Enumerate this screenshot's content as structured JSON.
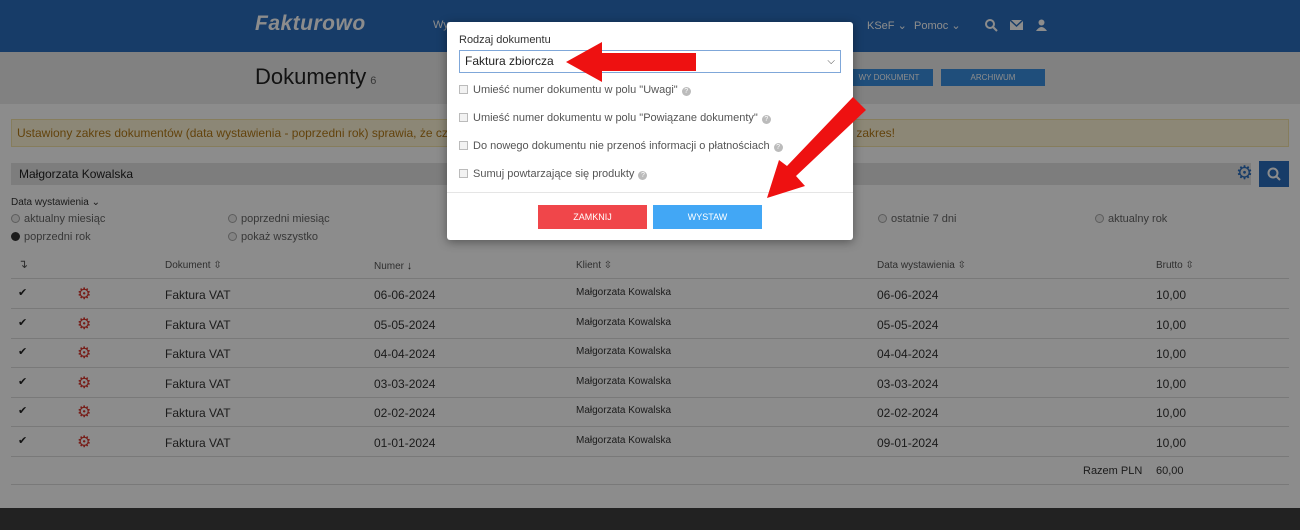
{
  "nav": {
    "logo": "Fakturowo",
    "first_item_partial": "Wy",
    "ksef": "KSeF",
    "help": "Pomoc"
  },
  "header": {
    "title": "Dokumenty",
    "count": "6",
    "new_doc_partial": "WY DOKUMENT",
    "archive": "ARCHIWUM"
  },
  "alert": {
    "text_start": "Ustawiony zakres dokumentów (data wystawienia - poprzedni rok) sprawia, że część d",
    "text_end": "y zakres!"
  },
  "client": {
    "name": "Małgorzata Kowalska"
  },
  "filter": {
    "label": "Data wystawienia",
    "options": [
      "aktualny miesiąc",
      "poprzedni miesiąc",
      "ostatnie 7 dni",
      "aktualny rok",
      "poprzedni rok",
      "pokaż wszystko"
    ],
    "selected": "poprzedni rok"
  },
  "table": {
    "headers": {
      "document": "Dokument",
      "number": "Numer",
      "client": "Klient",
      "date": "Data wystawienia",
      "gross": "Brutto"
    },
    "rows": [
      {
        "document": "Faktura VAT",
        "number": "06-06-2024",
        "client": "Małgorzata Kowalska",
        "date": "06-06-2024",
        "gross": "10,00"
      },
      {
        "document": "Faktura VAT",
        "number": "05-05-2024",
        "client": "Małgorzata Kowalska",
        "date": "05-05-2024",
        "gross": "10,00"
      },
      {
        "document": "Faktura VAT",
        "number": "04-04-2024",
        "client": "Małgorzata Kowalska",
        "date": "04-04-2024",
        "gross": "10,00"
      },
      {
        "document": "Faktura VAT",
        "number": "03-03-2024",
        "client": "Małgorzata Kowalska",
        "date": "03-03-2024",
        "gross": "10,00"
      },
      {
        "document": "Faktura VAT",
        "number": "02-02-2024",
        "client": "Małgorzata Kowalska",
        "date": "02-02-2024",
        "gross": "10,00"
      },
      {
        "document": "Faktura VAT",
        "number": "01-01-2024",
        "client": "Małgorzata Kowalska",
        "date": "09-01-2024",
        "gross": "10,00"
      }
    ],
    "total_label": "Razem PLN",
    "total_value": "60,00"
  },
  "modal": {
    "doc_type_label": "Rodzaj dokumentu",
    "doc_type_value": "Faktura zbiorcza",
    "options": [
      "Umieść numer dokumentu w polu \"Uwagi\"",
      "Umieść numer dokumentu w polu \"Powiązane dokumenty\"",
      "Do nowego dokumentu nie przenoś informacji o płatnościach",
      "Sumuj powtarzające się produkty"
    ],
    "close_button": "ZAMKNIJ",
    "issue_button": "WYSTAW"
  },
  "colors": {
    "brand_blue": "#2a6ebd",
    "close_red": "#f0464a",
    "issue_blue": "#42a7f5",
    "annotation_arrow": "#ee1111"
  },
  "icons": [
    "search-icon",
    "mail-icon",
    "user-icon",
    "gear-icon",
    "check-icon",
    "help-icon",
    "chevron-down-icon",
    "sort-icon"
  ]
}
